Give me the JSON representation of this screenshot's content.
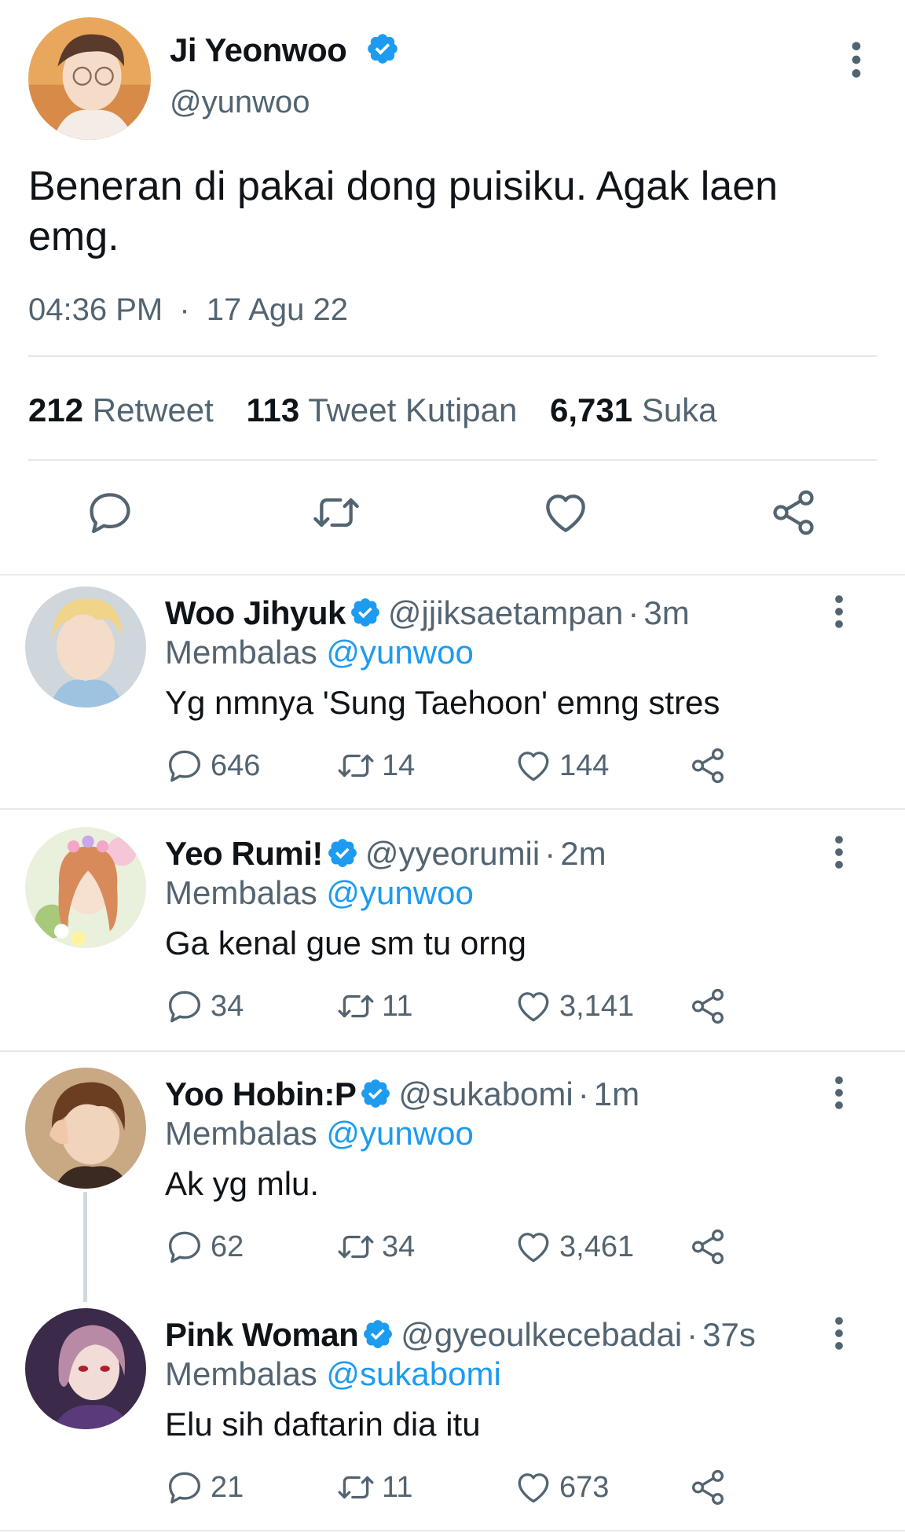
{
  "main_tweet": {
    "name": "Ji Yeonwoo",
    "handle": "@yunwoo",
    "text": "Beneran di pakai dong puisiku. Agak laen emg.",
    "time": "04:36 PM",
    "separator": "·",
    "date": "17 Agu 22",
    "stats": {
      "retweets": "212",
      "retweets_label": "Retweet",
      "quotes": "113",
      "quotes_label": "Tweet Kutipan",
      "likes": "6,731",
      "likes_label": "Suka"
    }
  },
  "replies": [
    {
      "name": "Woo Jihyuk",
      "handle": "@jjiksaetampan",
      "time": "3m",
      "replying_label": "Membalas",
      "replying_to": "@yunwoo",
      "text": "Yg nmnya 'Sung Taehoon' emng stres",
      "replies": "646",
      "retweets": "14",
      "likes": "144"
    },
    {
      "name": "Yeo Rumi!",
      "handle": "@yyeorumii",
      "time": "2m",
      "replying_label": "Membalas",
      "replying_to": "@yunwoo",
      "text": "Ga kenal gue sm tu orng",
      "replies": "34",
      "retweets": "11",
      "likes": "3,141"
    },
    {
      "name": "Yoo Hobin:P",
      "handle": "@sukabomi",
      "time": "1m",
      "replying_label": "Membalas",
      "replying_to": "@yunwoo",
      "text": "Ak yg mlu.",
      "replies": "62",
      "retweets": "34",
      "likes": "3,461"
    },
    {
      "name": "Pink Woman",
      "handle": "@gyeoulkecebadai",
      "time": "37s",
      "replying_label": "Membalas",
      "replying_to": "@sukabomi",
      "text": "Elu sih daftarin dia itu",
      "replies": "21",
      "retweets": "11",
      "likes": "673"
    }
  ],
  "colors": {
    "accent": "#1d9bf0",
    "secondary_text": "#536471",
    "divider": "#e4e8eb"
  },
  "icons": [
    "verified-badge-icon",
    "more-vertical-icon",
    "reply-icon",
    "retweet-icon",
    "like-icon",
    "share-icon"
  ]
}
